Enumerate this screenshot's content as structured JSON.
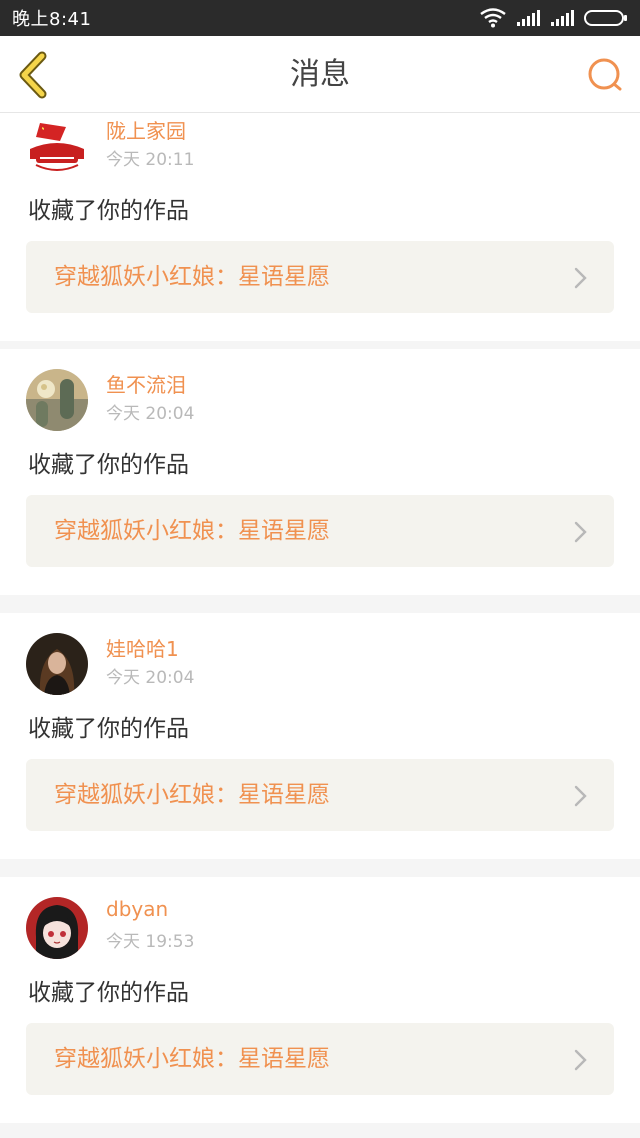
{
  "status_bar": {
    "time": "晚上8:41"
  },
  "nav": {
    "title": "消息",
    "back_icon": "chevron-left-icon",
    "search_icon": "search-icon"
  },
  "colors": {
    "accent": "#f09150",
    "back_arrow": "#f5d54a",
    "card_bg": "#f4f3ee",
    "page_bg": "#f5f5f5"
  },
  "messages": [
    {
      "user": "陇上家园",
      "time": "今天 20:11",
      "action": "收藏了你的作品",
      "work": "穿越狐妖小红娘：星语星愿"
    },
    {
      "user": "鱼不流泪",
      "time": "今天 20:04",
      "action": "收藏了你的作品",
      "work": "穿越狐妖小红娘：星语星愿"
    },
    {
      "user": "娃哈哈1",
      "time": "今天 20:04",
      "action": "收藏了你的作品",
      "work": "穿越狐妖小红娘：星语星愿"
    },
    {
      "user": "dbyan",
      "time": "今天 19:53",
      "action": "收藏了你的作品",
      "work": "穿越狐妖小红娘：星语星愿"
    }
  ]
}
